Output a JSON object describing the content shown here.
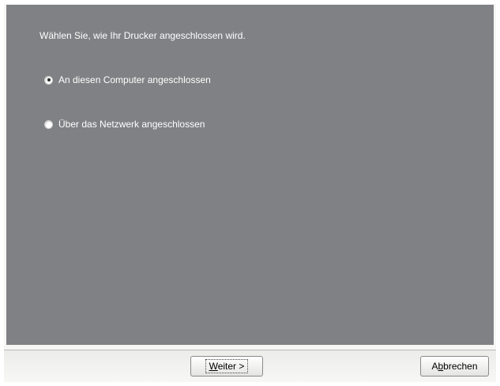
{
  "dialog": {
    "prompt": "Wählen Sie, wie Ihr Drucker angeschlossen wird.",
    "options": [
      {
        "label": "An diesen Computer angeschlossen",
        "selected": true
      },
      {
        "label": "Über das Netzwerk angeschlossen",
        "selected": false
      }
    ]
  },
  "footer": {
    "next_mnemonic": "W",
    "next_rest": "eiter >",
    "cancel_before": "A",
    "cancel_mnemonic": "b",
    "cancel_after": "brechen"
  }
}
